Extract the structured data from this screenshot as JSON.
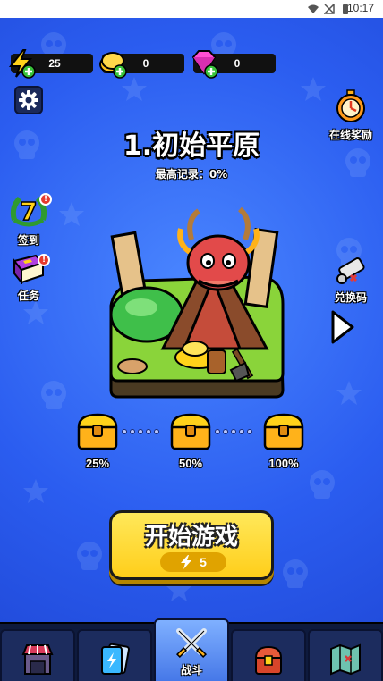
{
  "status_bar": {
    "time": "10:17"
  },
  "resources": {
    "energy": "25",
    "coins": "0",
    "gems": "0"
  },
  "level": {
    "title": "1.初始平原",
    "record": "最高记录：0%"
  },
  "side_buttons": {
    "online_reward": "在线奖励",
    "signin": "签到",
    "signin_day": "7",
    "tasks": "任务",
    "redeem": "兑换码",
    "badge": "!"
  },
  "progress": {
    "milestones": [
      "25%",
      "50%",
      "100%"
    ]
  },
  "start": {
    "label": "开始游戏",
    "cost": "5"
  },
  "nav": {
    "tabs": [
      "shop",
      "cards",
      "battle",
      "chest",
      "map"
    ],
    "active_label": "战斗"
  },
  "colors": {
    "background": "#2b5df0",
    "start_button": "#ffce1a",
    "navbar": "#0e1a3d",
    "active_tab": "#4678e8"
  }
}
